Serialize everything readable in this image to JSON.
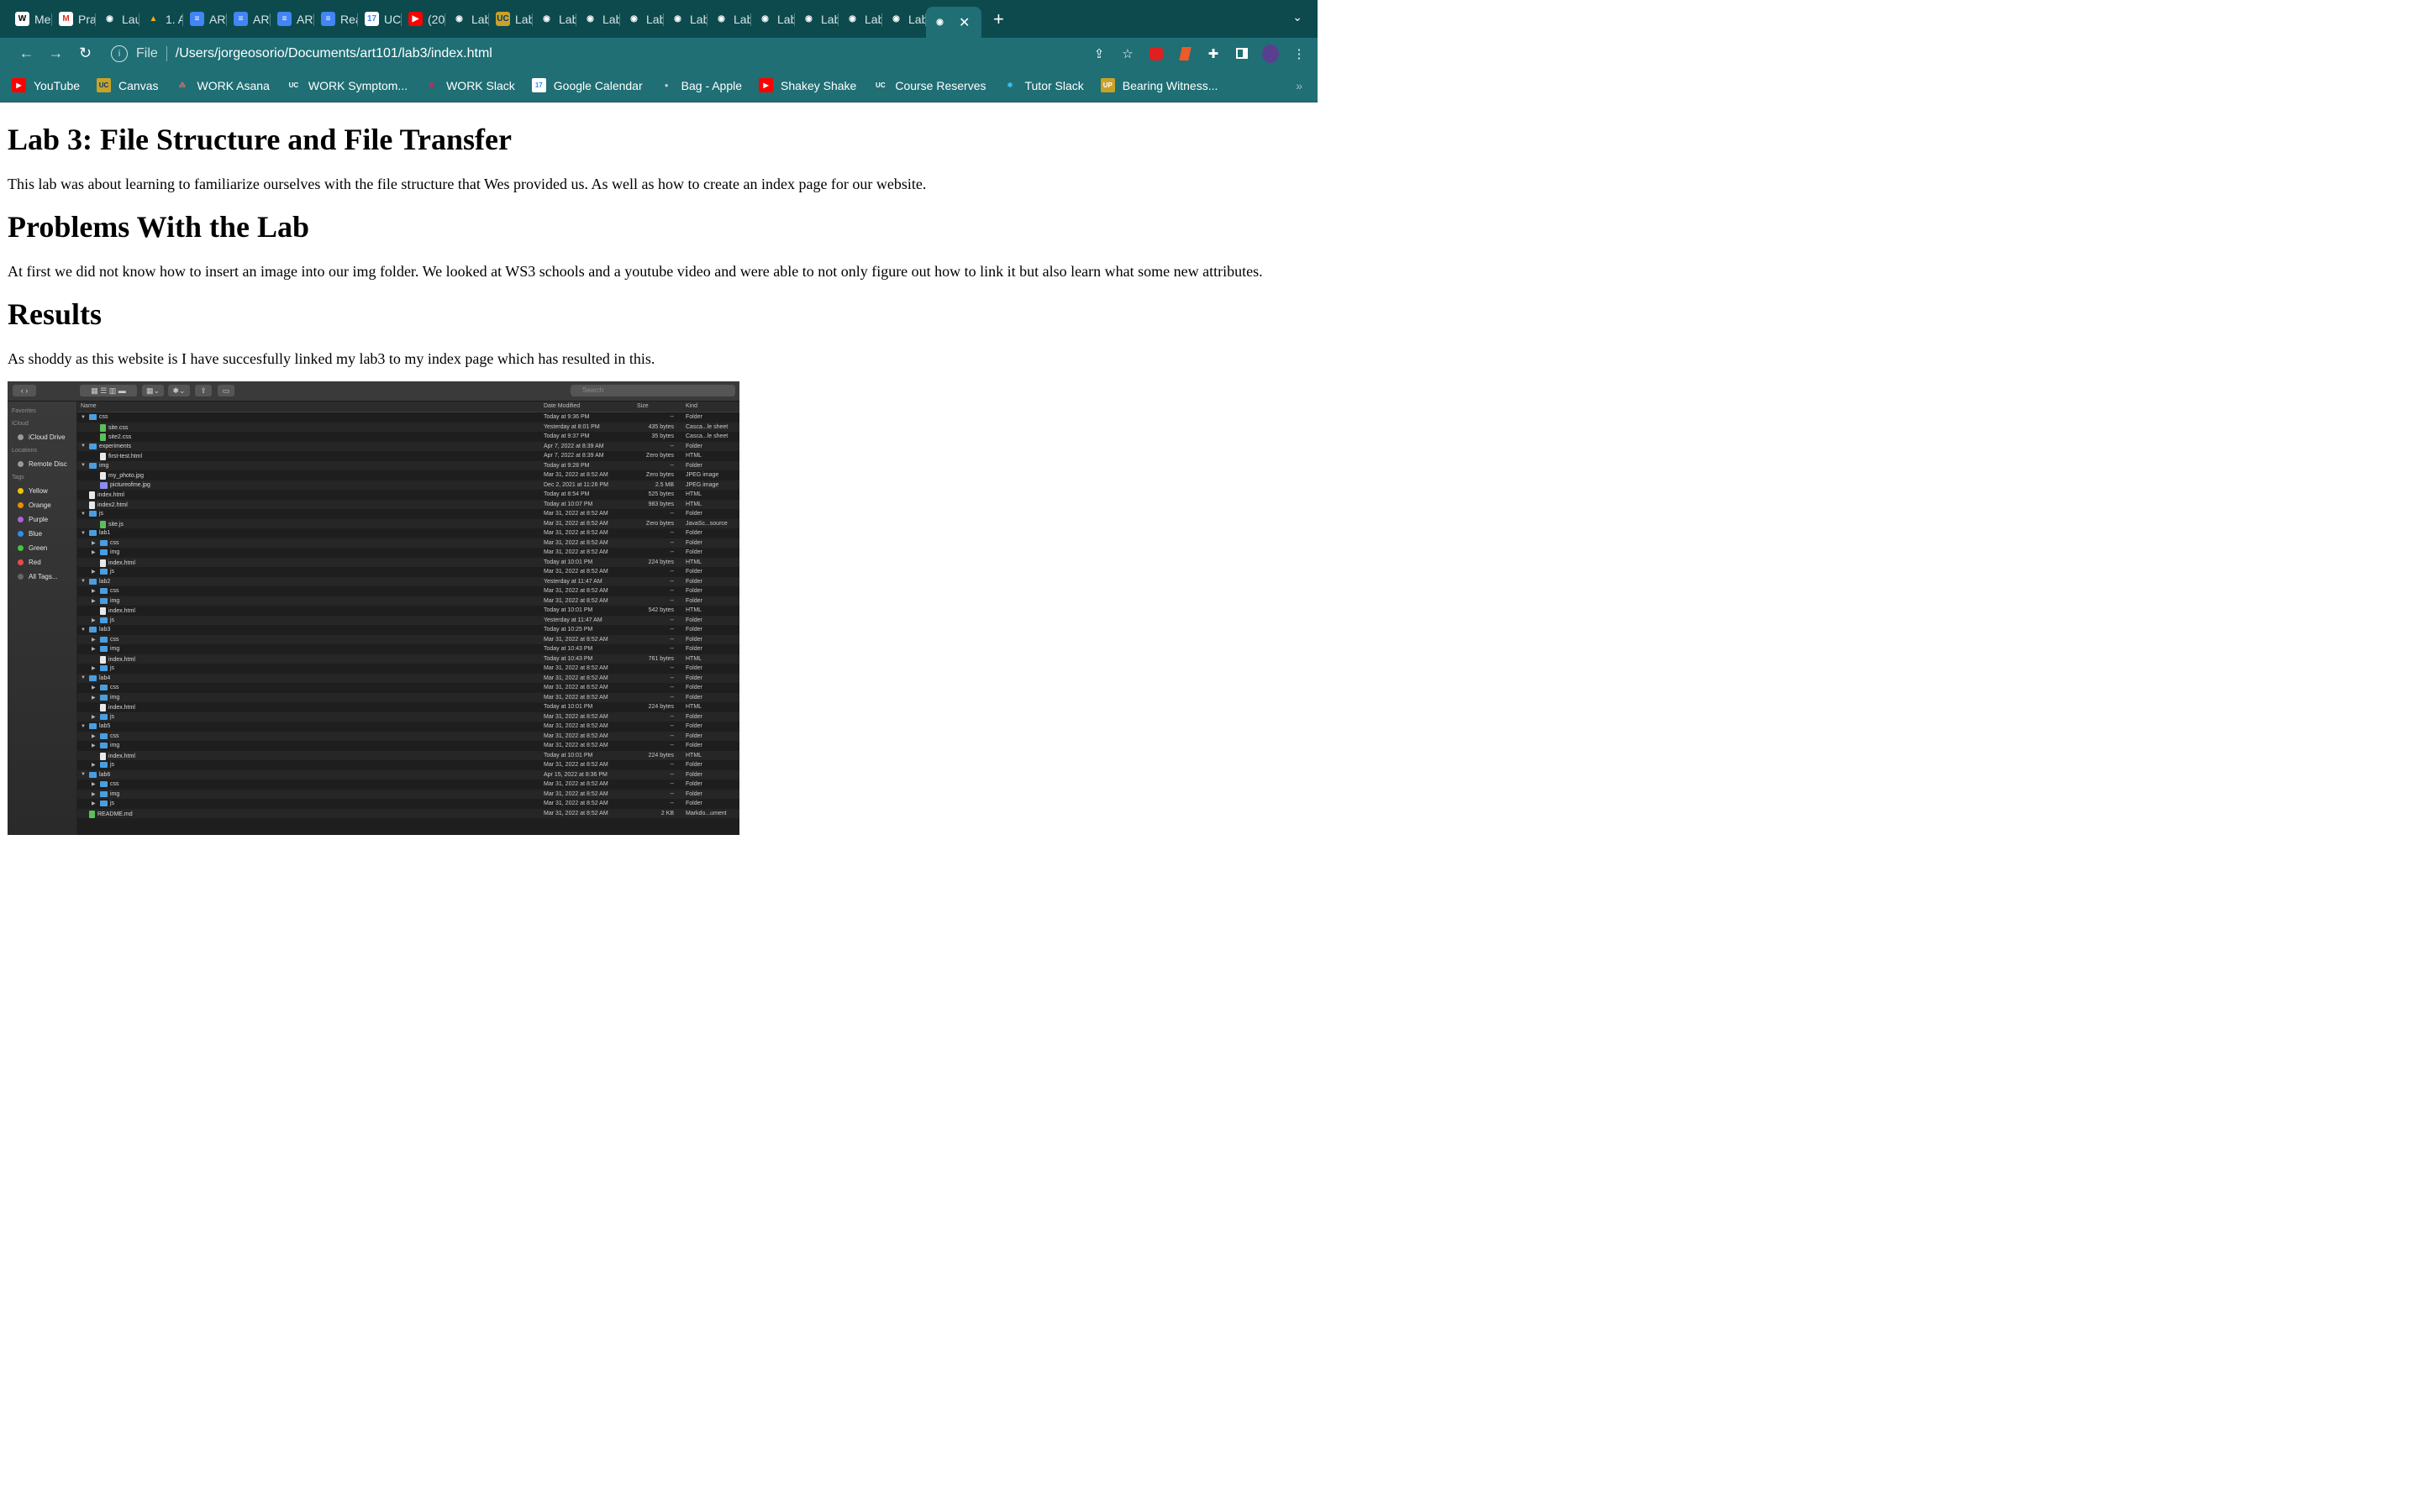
{
  "tabs": [
    {
      "label": "Mel",
      "icon": "wikipedia-icon",
      "color": "#ffffff",
      "text": "W",
      "textColor": "#000"
    },
    {
      "label": "Pra",
      "icon": "gmail-icon",
      "color": "#ffffff",
      "text": "M",
      "textColor": "#d93025"
    },
    {
      "label": "Lau",
      "icon": "globe-icon",
      "color": "#0d4a4e",
      "text": "◉",
      "textColor": "#fff"
    },
    {
      "label": "1. A",
      "icon": "google-drive-icon",
      "color": "#0d4a4e",
      "text": "▲",
      "textColor": "#f4b400"
    },
    {
      "label": "ART",
      "icon": "google-docs-icon",
      "color": "#4285f4",
      "text": "≡",
      "textColor": "#fff"
    },
    {
      "label": "ART",
      "icon": "google-docs-icon",
      "color": "#4285f4",
      "text": "≡",
      "textColor": "#fff"
    },
    {
      "label": "ART",
      "icon": "google-docs-icon",
      "color": "#4285f4",
      "text": "≡",
      "textColor": "#fff"
    },
    {
      "label": "Rea",
      "icon": "google-docs-icon",
      "color": "#4285f4",
      "text": "≡",
      "textColor": "#fff"
    },
    {
      "label": "UC",
      "icon": "google-calendar-icon",
      "color": "#ffffff",
      "text": "17",
      "textColor": "#4285f4"
    },
    {
      "label": "(20",
      "icon": "youtube-icon",
      "color": "#ff0000",
      "text": "▶",
      "textColor": "#fff"
    },
    {
      "label": "Lab",
      "icon": "globe-icon",
      "color": "#0d4a4e",
      "text": "◉",
      "textColor": "#fff"
    },
    {
      "label": "Lab",
      "icon": "ucsc-icon",
      "color": "#c9a227",
      "text": "UC",
      "textColor": "#003c6c"
    },
    {
      "label": "Lab",
      "icon": "globe-icon",
      "color": "#0d4a4e",
      "text": "◉",
      "textColor": "#fff"
    },
    {
      "label": "Lab",
      "icon": "globe-icon",
      "color": "#0d4a4e",
      "text": "◉",
      "textColor": "#fff"
    },
    {
      "label": "Lab",
      "icon": "globe-icon",
      "color": "#0d4a4e",
      "text": "◉",
      "textColor": "#fff"
    },
    {
      "label": "Lab",
      "icon": "globe-icon",
      "color": "#0d4a4e",
      "text": "◉",
      "textColor": "#fff"
    },
    {
      "label": "Lab",
      "icon": "globe-icon",
      "color": "#0d4a4e",
      "text": "◉",
      "textColor": "#fff"
    },
    {
      "label": "Lab",
      "icon": "globe-icon",
      "color": "#0d4a4e",
      "text": "◉",
      "textColor": "#fff"
    },
    {
      "label": "Lab",
      "icon": "globe-icon",
      "color": "#0d4a4e",
      "text": "◉",
      "textColor": "#fff"
    },
    {
      "label": "Lab",
      "icon": "globe-icon",
      "color": "#0d4a4e",
      "text": "◉",
      "textColor": "#fff"
    },
    {
      "label": "Lab",
      "icon": "globe-icon",
      "color": "#0d4a4e",
      "text": "◉",
      "textColor": "#fff"
    }
  ],
  "active_tab": {
    "icon": "globe-icon",
    "close": "✕"
  },
  "new_tab": "+",
  "tab_menu": "⌄",
  "nav": {
    "back": "←",
    "forward": "→",
    "reload": "↻"
  },
  "address": {
    "scheme": "File",
    "url": "/Users/jorgeosorio/Documents/art101/lab3/index.html"
  },
  "bookmarks": [
    {
      "label": "YouTube",
      "icon": "youtube-icon",
      "bg": "#ff0000",
      "glyph": "▶",
      "fg": "#fff"
    },
    {
      "label": "Canvas",
      "icon": "ucsc-icon",
      "bg": "#c9a227",
      "glyph": "UC",
      "fg": "#003c6c"
    },
    {
      "label": "WORK Asana",
      "icon": "asana-icon",
      "bg": "transparent",
      "glyph": "⁂",
      "fg": "#f06a6a"
    },
    {
      "label": "WORK Symptom...",
      "icon": "ucsc-icon",
      "bg": "transparent",
      "glyph": "UC",
      "fg": "#fff"
    },
    {
      "label": "WORK Slack",
      "icon": "slack-icon",
      "bg": "transparent",
      "glyph": "✱",
      "fg": "#e01e5a"
    },
    {
      "label": "Google Calendar",
      "icon": "google-calendar-icon",
      "bg": "#ffffff",
      "glyph": "17",
      "fg": "#4285f4"
    },
    {
      "label": "Bag - Apple",
      "icon": "apple-icon",
      "bg": "transparent",
      "glyph": "●",
      "fg": "#cfcfcf"
    },
    {
      "label": "Shakey Shake",
      "icon": "youtube-icon",
      "bg": "#ff0000",
      "glyph": "▶",
      "fg": "#fff"
    },
    {
      "label": "Course Reserves",
      "icon": "ucsc-icon",
      "bg": "transparent",
      "glyph": "UC",
      "fg": "#fff"
    },
    {
      "label": "Tutor Slack",
      "icon": "slack-icon",
      "bg": "transparent",
      "glyph": "✱",
      "fg": "#36c5f0"
    },
    {
      "label": "Bearing Witness...",
      "icon": "upso-icon",
      "bg": "#c9a227",
      "glyph": "UP",
      "fg": "#fff"
    }
  ],
  "bookmarks_more": "»",
  "page": {
    "h1": "Lab 3: File Structure and File Transfer",
    "intro": "This lab was about learning to familiarize ourselves with the file structure that Wes provided us. As well as how to create an index page for our website.",
    "h_problems": "Problems With the Lab",
    "problems": "At first we did not know how to insert an image into our img folder. We looked at WS3 schools and a youtube video and were able to not only figure out how to link it but also learn what some new attributes.",
    "h_results": "Results",
    "results": "As shoddy as this website is I have succesfully linked my lab3 to my index page which has resulted in this."
  },
  "finder": {
    "search_placeholder": "Search",
    "sidebar": [
      {
        "type": "h",
        "label": "Favorites"
      },
      {
        "type": "h",
        "label": "iCloud"
      },
      {
        "type": "i",
        "label": "iCloud Drive",
        "color": "#9a9a9a"
      },
      {
        "type": "h",
        "label": "Locations"
      },
      {
        "type": "i",
        "label": "Remote Disc",
        "color": "#9a9a9a"
      },
      {
        "type": "h",
        "label": "Tags"
      },
      {
        "type": "i",
        "label": "Yellow",
        "color": "#f5c400"
      },
      {
        "type": "i",
        "label": "Orange",
        "color": "#f08c00"
      },
      {
        "type": "i",
        "label": "Purple",
        "color": "#b060e0"
      },
      {
        "type": "i",
        "label": "Blue",
        "color": "#2e8ef0"
      },
      {
        "type": "i",
        "label": "Green",
        "color": "#3fc63f"
      },
      {
        "type": "i",
        "label": "Red",
        "color": "#f04848"
      },
      {
        "type": "i",
        "label": "All Tags...",
        "color": "#666666"
      }
    ],
    "columns": {
      "name": "Name",
      "date": "Date Modified",
      "size": "Size",
      "kind": "Kind"
    },
    "rows": [
      {
        "d": 0,
        "t": "o",
        "k": "folder",
        "n": "css",
        "dm": "Today at 9:36 PM",
        "s": "--",
        "kd": "Folder"
      },
      {
        "d": 1,
        "t": "",
        "k": "css",
        "n": "site.css",
        "dm": "Yesterday at 8:01 PM",
        "s": "435 bytes",
        "kd": "Casca...le sheet"
      },
      {
        "d": 1,
        "t": "",
        "k": "css",
        "n": "site2.css",
        "dm": "Today at 9:37 PM",
        "s": "35 bytes",
        "kd": "Casca...le sheet"
      },
      {
        "d": 0,
        "t": "o",
        "k": "folder",
        "n": "experiments",
        "dm": "Apr 7, 2022 at 8:39 AM",
        "s": "--",
        "kd": "Folder"
      },
      {
        "d": 1,
        "t": "",
        "k": "file",
        "n": "first-test.html",
        "dm": "Apr 7, 2022 at 8:39 AM",
        "s": "Zero bytes",
        "kd": "HTML"
      },
      {
        "d": 0,
        "t": "o",
        "k": "folder",
        "n": "img",
        "dm": "Today at 9:28 PM",
        "s": "--",
        "kd": "Folder"
      },
      {
        "d": 1,
        "t": "",
        "k": "file",
        "n": "my_photo.jpg",
        "dm": "Mar 31, 2022 at 8:52 AM",
        "s": "Zero bytes",
        "kd": "JPEG image"
      },
      {
        "d": 1,
        "t": "",
        "k": "img",
        "n": "pictureofme.jpg",
        "dm": "Dec 2, 2021 at 11:26 PM",
        "s": "2.5 MB",
        "kd": "JPEG image"
      },
      {
        "d": 0,
        "t": "",
        "k": "file",
        "n": "index.html",
        "dm": "Today at 8:54 PM",
        "s": "525 bytes",
        "kd": "HTML"
      },
      {
        "d": 0,
        "t": "",
        "k": "file",
        "n": "index2.html",
        "dm": "Today at 10:07 PM",
        "s": "983 bytes",
        "kd": "HTML"
      },
      {
        "d": 0,
        "t": "o",
        "k": "folder",
        "n": "js",
        "dm": "Mar 31, 2022 at 8:52 AM",
        "s": "--",
        "kd": "Folder"
      },
      {
        "d": 1,
        "t": "",
        "k": "css",
        "n": "site.js",
        "dm": "Mar 31, 2022 at 8:52 AM",
        "s": "Zero bytes",
        "kd": "JavaSc...source"
      },
      {
        "d": 0,
        "t": "o",
        "k": "folder",
        "n": "lab1",
        "dm": "Mar 31, 2022 at 8:52 AM",
        "s": "--",
        "kd": "Folder"
      },
      {
        "d": 1,
        "t": "c",
        "k": "folder",
        "n": "css",
        "dm": "Mar 31, 2022 at 8:52 AM",
        "s": "--",
        "kd": "Folder"
      },
      {
        "d": 1,
        "t": "c",
        "k": "folder",
        "n": "img",
        "dm": "Mar 31, 2022 at 8:52 AM",
        "s": "--",
        "kd": "Folder"
      },
      {
        "d": 1,
        "t": "",
        "k": "file",
        "n": "index.html",
        "dm": "Today at 10:01 PM",
        "s": "224 bytes",
        "kd": "HTML"
      },
      {
        "d": 1,
        "t": "c",
        "k": "folder",
        "n": "js",
        "dm": "Mar 31, 2022 at 8:52 AM",
        "s": "--",
        "kd": "Folder"
      },
      {
        "d": 0,
        "t": "o",
        "k": "folder",
        "n": "lab2",
        "dm": "Yesterday at 11:47 AM",
        "s": "--",
        "kd": "Folder"
      },
      {
        "d": 1,
        "t": "c",
        "k": "folder",
        "n": "css",
        "dm": "Mar 31, 2022 at 8:52 AM",
        "s": "--",
        "kd": "Folder"
      },
      {
        "d": 1,
        "t": "c",
        "k": "folder",
        "n": "img",
        "dm": "Mar 31, 2022 at 8:52 AM",
        "s": "--",
        "kd": "Folder"
      },
      {
        "d": 1,
        "t": "",
        "k": "file",
        "n": "index.html",
        "dm": "Today at 10:01 PM",
        "s": "542 bytes",
        "kd": "HTML"
      },
      {
        "d": 1,
        "t": "c",
        "k": "folder",
        "n": "js",
        "dm": "Yesterday at 11:47 AM",
        "s": "--",
        "kd": "Folder"
      },
      {
        "d": 0,
        "t": "o",
        "k": "folder",
        "n": "lab3",
        "dm": "Today at 10:25 PM",
        "s": "--",
        "kd": "Folder"
      },
      {
        "d": 1,
        "t": "c",
        "k": "folder",
        "n": "css",
        "dm": "Mar 31, 2022 at 8:52 AM",
        "s": "--",
        "kd": "Folder"
      },
      {
        "d": 1,
        "t": "c",
        "k": "folder",
        "n": "img",
        "dm": "Today at 10:43 PM",
        "s": "--",
        "kd": "Folder"
      },
      {
        "d": 1,
        "t": "",
        "k": "file",
        "n": "index.html",
        "dm": "Today at 10:43 PM",
        "s": "761 bytes",
        "kd": "HTML"
      },
      {
        "d": 1,
        "t": "c",
        "k": "folder",
        "n": "js",
        "dm": "Mar 31, 2022 at 8:52 AM",
        "s": "--",
        "kd": "Folder"
      },
      {
        "d": 0,
        "t": "o",
        "k": "folder",
        "n": "lab4",
        "dm": "Mar 31, 2022 at 8:52 AM",
        "s": "--",
        "kd": "Folder"
      },
      {
        "d": 1,
        "t": "c",
        "k": "folder",
        "n": "css",
        "dm": "Mar 31, 2022 at 8:52 AM",
        "s": "--",
        "kd": "Folder"
      },
      {
        "d": 1,
        "t": "c",
        "k": "folder",
        "n": "img",
        "dm": "Mar 31, 2022 at 8:52 AM",
        "s": "--",
        "kd": "Folder"
      },
      {
        "d": 1,
        "t": "",
        "k": "file",
        "n": "index.html",
        "dm": "Today at 10:01 PM",
        "s": "224 bytes",
        "kd": "HTML"
      },
      {
        "d": 1,
        "t": "c",
        "k": "folder",
        "n": "js",
        "dm": "Mar 31, 2022 at 8:52 AM",
        "s": "--",
        "kd": "Folder"
      },
      {
        "d": 0,
        "t": "o",
        "k": "folder",
        "n": "lab5",
        "dm": "Mar 31, 2022 at 8:52 AM",
        "s": "--",
        "kd": "Folder"
      },
      {
        "d": 1,
        "t": "c",
        "k": "folder",
        "n": "css",
        "dm": "Mar 31, 2022 at 8:52 AM",
        "s": "--",
        "kd": "Folder"
      },
      {
        "d": 1,
        "t": "c",
        "k": "folder",
        "n": "img",
        "dm": "Mar 31, 2022 at 8:52 AM",
        "s": "--",
        "kd": "Folder"
      },
      {
        "d": 1,
        "t": "",
        "k": "file",
        "n": "index.html",
        "dm": "Today at 10:01 PM",
        "s": "224 bytes",
        "kd": "HTML"
      },
      {
        "d": 1,
        "t": "c",
        "k": "folder",
        "n": "js",
        "dm": "Mar 31, 2022 at 8:52 AM",
        "s": "--",
        "kd": "Folder"
      },
      {
        "d": 0,
        "t": "o",
        "k": "folder",
        "n": "lab6",
        "dm": "Apr 15, 2022 at 8:36 PM",
        "s": "--",
        "kd": "Folder"
      },
      {
        "d": 1,
        "t": "c",
        "k": "folder",
        "n": "css",
        "dm": "Mar 31, 2022 at 8:52 AM",
        "s": "--",
        "kd": "Folder"
      },
      {
        "d": 1,
        "t": "c",
        "k": "folder",
        "n": "img",
        "dm": "Mar 31, 2022 at 8:52 AM",
        "s": "--",
        "kd": "Folder"
      },
      {
        "d": 1,
        "t": "c",
        "k": "folder",
        "n": "js",
        "dm": "Mar 31, 2022 at 8:52 AM",
        "s": "--",
        "kd": "Folder"
      },
      {
        "d": 0,
        "t": "",
        "k": "css",
        "n": "README.md",
        "dm": "Mar 31, 2022 at 8:52 AM",
        "s": "2 KB",
        "kd": "Markdo...ument"
      }
    ]
  }
}
